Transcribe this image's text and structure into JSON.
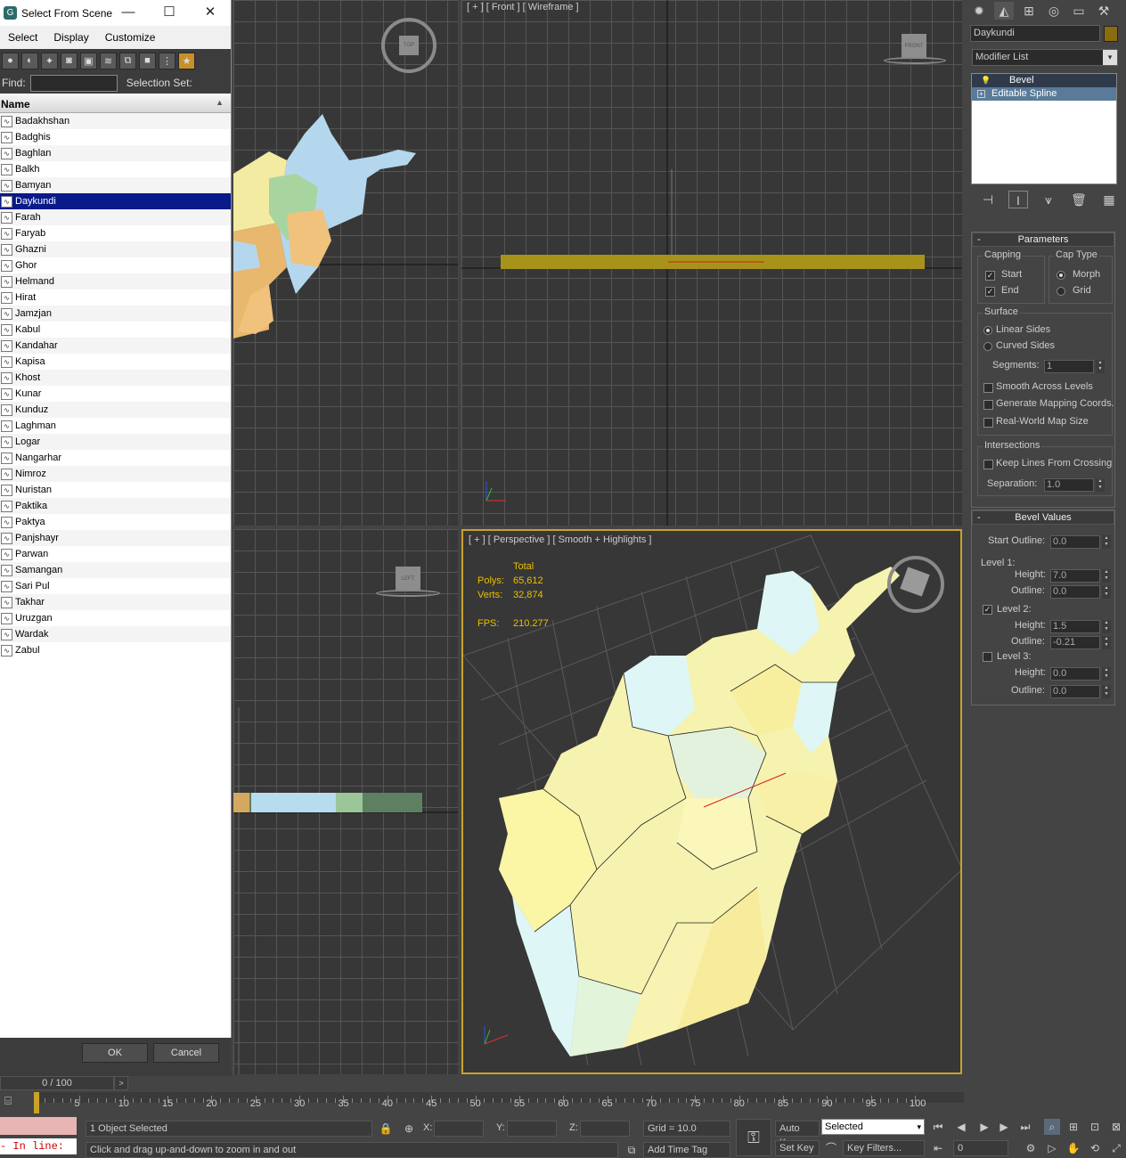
{
  "dialog": {
    "title": "Select From Scene",
    "menu": [
      "Select",
      "Display",
      "Customize"
    ],
    "find_label": "Find:",
    "selection_set_label": "Selection Set:",
    "column_header": "Name",
    "objects": [
      "Badakhshan",
      "Badghis",
      "Baghlan",
      "Balkh",
      "Bamyan",
      "Daykundi",
      "Farah",
      "Faryab",
      "Ghazni",
      "Ghor",
      "Helmand",
      "Hirat",
      "Jamzjan",
      "Kabul",
      "Kandahar",
      "Kapisa",
      "Khost",
      "Kunar",
      "Kunduz",
      "Laghman",
      "Logar",
      "Nangarhar",
      "Nimroz",
      "Nuristan",
      "Paktika",
      "Paktya",
      "Panjshayr",
      "Parwan",
      "Samangan",
      "Sari Pul",
      "Takhar",
      "Uruzgan",
      "Wardak",
      "Zabul"
    ],
    "selected": "Daykundi",
    "ok_label": "OK",
    "cancel_label": "Cancel"
  },
  "viewports": {
    "top_label": "TOP",
    "front_label": "[ + ] [ Front ] [ Wireframe ]",
    "front_cube": "FRONT",
    "left_cube": "LEFT",
    "perspective_label": "[ + ] [ Perspective ] [ Smooth + Highlights ]",
    "stats": {
      "total_label": "Total",
      "polys_label": "Polys:",
      "polys": "65,612",
      "verts_label": "Verts:",
      "verts": "32,874",
      "fps_label": "FPS:",
      "fps": "210.277"
    }
  },
  "command_panel": {
    "object_name": "Daykundi",
    "object_color": "#8a6d10",
    "modifier_list": "Modifier List",
    "stack": [
      "Bevel",
      "Editable Spline"
    ],
    "parameters": {
      "title": "Parameters",
      "capping": "Capping",
      "start": "Start",
      "end": "End",
      "cap_type": "Cap Type",
      "morph": "Morph",
      "grid": "Grid",
      "surface": "Surface",
      "linear_sides": "Linear Sides",
      "curved_sides": "Curved Sides",
      "segments_label": "Segments:",
      "segments": "1",
      "smooth_across_levels": "Smooth Across Levels",
      "generate_mapping": "Generate Mapping Coords.",
      "real_world_map": "Real-World Map Size",
      "intersections": "Intersections",
      "keep_lines": "Keep Lines From Crossing",
      "separation_label": "Separation:",
      "separation": "1.0"
    },
    "bevel_values": {
      "title": "Bevel Values",
      "start_outline_label": "Start Outline:",
      "start_outline": "0.0",
      "level1": "Level 1:",
      "height_label": "Height:",
      "outline_label": "Outline:",
      "l1_height": "7.0",
      "l1_outline": "0.0",
      "level2": "Level 2:",
      "l2_height": "1.5",
      "l2_outline": "-0.21",
      "level3": "Level 3:",
      "l3_height": "0.0",
      "l3_outline": "0.0"
    }
  },
  "timeline": {
    "frame_readout": "0 / 100",
    "ticks": [
      "5",
      "10",
      "15",
      "20",
      "25",
      "30",
      "35",
      "40",
      "45",
      "50",
      "55",
      "60",
      "65",
      "70",
      "75",
      "80",
      "85",
      "90",
      "95",
      "100"
    ]
  },
  "status": {
    "script_label": "- In line:",
    "selection": "1 Object Selected",
    "prompt": "Click and drag up-and-down to zoom in and out",
    "x_label": "X:",
    "y_label": "Y:",
    "z_label": "Z:",
    "grid": "Grid = 10.0",
    "add_time_tag": "Add Time Tag",
    "auto_key": "Auto Key",
    "set_key": "Set Key",
    "selected_dropdown": "Selected",
    "key_filters": "Key Filters...",
    "frame_field": "0"
  }
}
